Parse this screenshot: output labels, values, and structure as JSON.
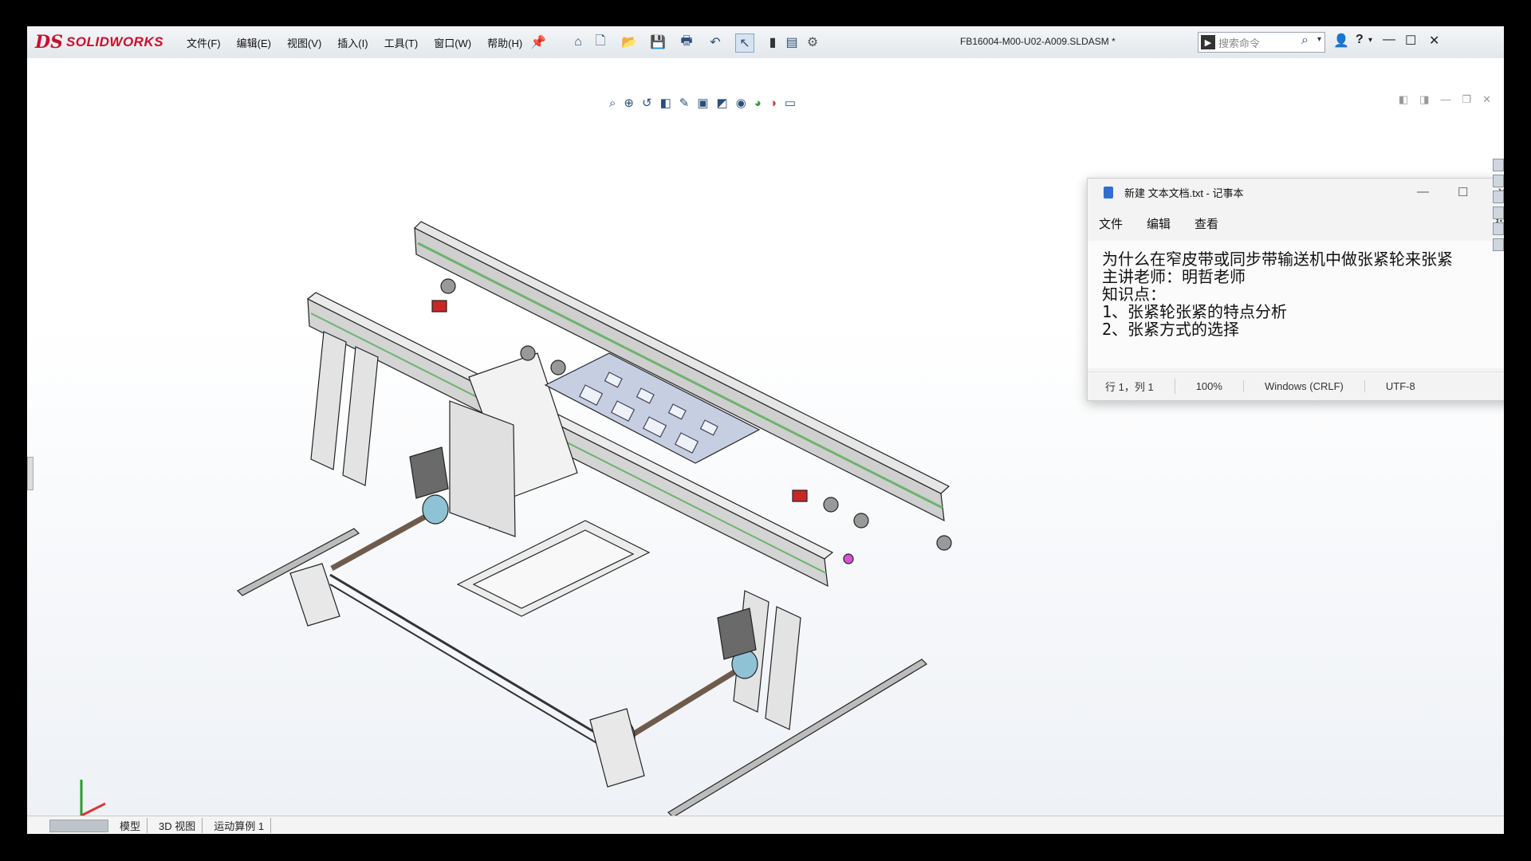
{
  "app": {
    "logo_ds": "DS",
    "logo_text": "SOLIDWORKS",
    "document_title": "FB16004-M00-U02-A009.SLDASM *",
    "search_placeholder": "搜索命令"
  },
  "menus": [
    "文件(F)",
    "编辑(E)",
    "视图(V)",
    "插入(I)",
    "工具(T)",
    "窗口(W)",
    "帮助(H)"
  ],
  "toolbar_icons": [
    "home-icon",
    "new-file-icon",
    "open-icon",
    "save-icon",
    "print-icon",
    "undo-icon",
    "select-icon",
    "traffic-light-icon",
    "file-properties-icon",
    "options-gear-icon"
  ],
  "heads_up_icons": [
    "zoom-to-fit-icon",
    "zoom-area-icon",
    "previous-view-icon",
    "section-view-icon",
    "dynamic-annotation-icon",
    "view-orientation-icon",
    "display-style-icon",
    "hide-show-icon",
    "edit-appearance-icon",
    "apply-scene-icon",
    "view-settings-icon"
  ],
  "bottom_tabs": [
    "模型",
    "3D 视图",
    "运动算例 1"
  ],
  "notepad": {
    "title": "新建 文本文档.txt - 记事本",
    "menu": [
      "文件",
      "编辑",
      "查看"
    ],
    "lines": [
      "为什么在窄皮带或同步带输送机中做张紧轮来张紧",
      "主讲老师：明哲老师",
      "知识点：",
      "1、张紧轮张紧的特点分析",
      "2、张紧方式的选择"
    ],
    "status": {
      "position": "行 1，列 1",
      "zoom": "100%",
      "line_ending": "Windows (CRLF)",
      "encoding": "UTF-8"
    }
  },
  "colors": {
    "brand": "#c8102e",
    "viewport_bg": "#ffffff",
    "model_gray": "#d9d9d9",
    "model_edge": "#222222",
    "belt_green": "#6db36d",
    "accent_blue": "#2b4f7a"
  }
}
